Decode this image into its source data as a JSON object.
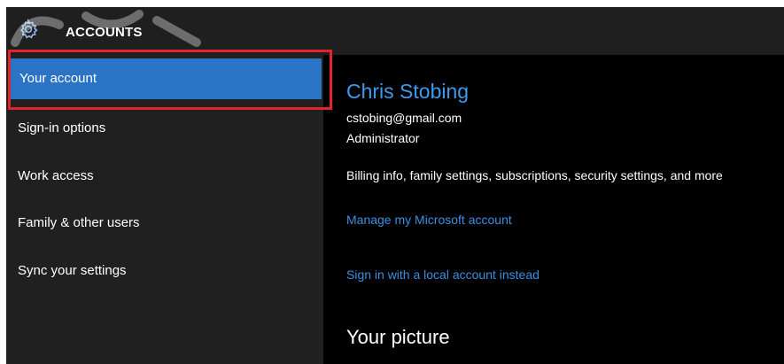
{
  "titlebar": {
    "title": "ACCOUNTS",
    "icon": "gear-icon"
  },
  "sidebar": {
    "items": [
      {
        "label": "Your account",
        "selected": true
      },
      {
        "label": "Sign-in options",
        "selected": false
      },
      {
        "label": "Work access",
        "selected": false
      },
      {
        "label": "Family & other users",
        "selected": false
      },
      {
        "label": "Sync your settings",
        "selected": false
      }
    ]
  },
  "account": {
    "name": "Chris Stobing",
    "email": "cstobing@gmail.com",
    "role": "Administrator",
    "billing_text": "Billing info, family settings, subscriptions, security settings, and more",
    "manage_link": "Manage my Microsoft account",
    "local_link": "Sign in with a local account instead"
  },
  "picture_section": {
    "heading": "Your picture"
  },
  "colors": {
    "accent": "#2b73c5",
    "link": "#3b8fe0",
    "highlight": "#e5232a",
    "sidebar_bg": "#202020",
    "content_bg": "#000000"
  }
}
